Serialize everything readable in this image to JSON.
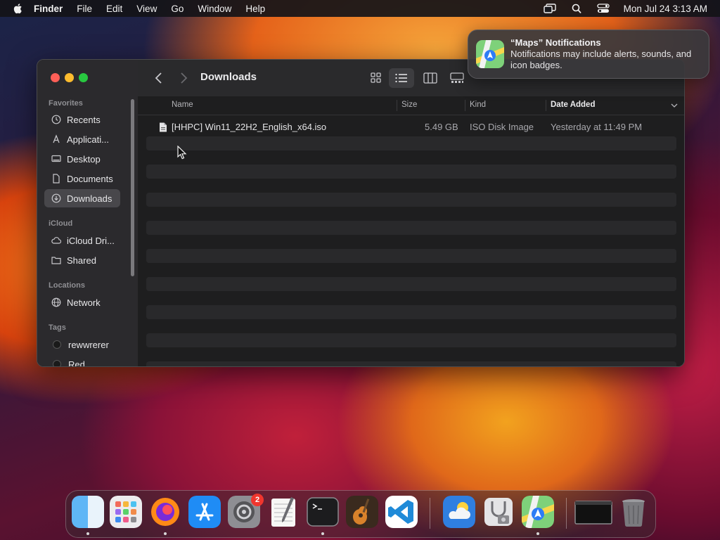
{
  "menubar": {
    "app_name": "Finder",
    "items": [
      "File",
      "Edit",
      "View",
      "Go",
      "Window",
      "Help"
    ],
    "clock": "Mon Jul 24  3:13 AM"
  },
  "window": {
    "title": "Downloads",
    "sidebar": {
      "favorites_header": "Favorites",
      "favorites": [
        "Recents",
        "Applicati...",
        "Desktop",
        "Documents",
        "Downloads"
      ],
      "icloud_header": "iCloud",
      "icloud": [
        "iCloud Dri...",
        "Shared"
      ],
      "locations_header": "Locations",
      "locations": [
        "Network"
      ],
      "tags_header": "Tags",
      "tags": [
        "rewwrerer",
        "Red"
      ]
    },
    "columns": {
      "name": "Name",
      "size": "Size",
      "kind": "Kind",
      "date_added": "Date Added"
    },
    "files": [
      {
        "name": "[HHPC] Win11_22H2_English_x64.iso",
        "size": "5.49 GB",
        "kind": "ISO Disk Image",
        "date_added": "Yesterday at 11:49 PM"
      }
    ]
  },
  "notification": {
    "title": "“Maps” Notifications",
    "body": "Notifications may include alerts, sounds, and icon badges."
  },
  "dock": {
    "apps": [
      "Finder",
      "Launchpad",
      "Firefox",
      "App Store",
      "System Settings",
      "TextEdit",
      "Terminal",
      "GarageBand",
      "Visual Studio Code",
      "Weather",
      "Disk Utility",
      "Maps",
      "Window Preview",
      "Trash"
    ],
    "settings_badge": "2"
  }
}
